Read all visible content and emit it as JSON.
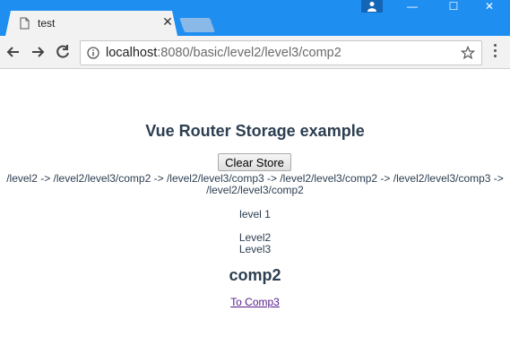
{
  "browser": {
    "tab": {
      "title": "test",
      "close_glyph": "✕"
    },
    "window_controls": {
      "minimize": "—",
      "maximize": "☐",
      "close": "✕"
    },
    "address_bar": {
      "host": "localhost",
      "path": ":8080/basic/level2/level3/comp2"
    },
    "icons": [
      "page-icon",
      "close-icon",
      "back-arrow-icon",
      "forward-arrow-icon",
      "reload-icon",
      "info-icon",
      "star-icon",
      "kebab-menu-icon",
      "profile-icon"
    ]
  },
  "page": {
    "title": "Vue Router Storage example",
    "clear_button": "Clear Store",
    "history": "/level2 -> /level2/level3/comp2 -> /level2/level3/comp3 -> /level2/level3/comp2 -> /level2/level3/comp3 -> /level2/level3/comp2",
    "level1": "level 1",
    "level2": "Level2",
    "level3": "Level3",
    "component_title": "comp2",
    "link_text": "To Comp3"
  },
  "colors": {
    "titlebar": "#1f8ef1",
    "text": "#2c3e50",
    "visited_link": "#551a8b"
  }
}
